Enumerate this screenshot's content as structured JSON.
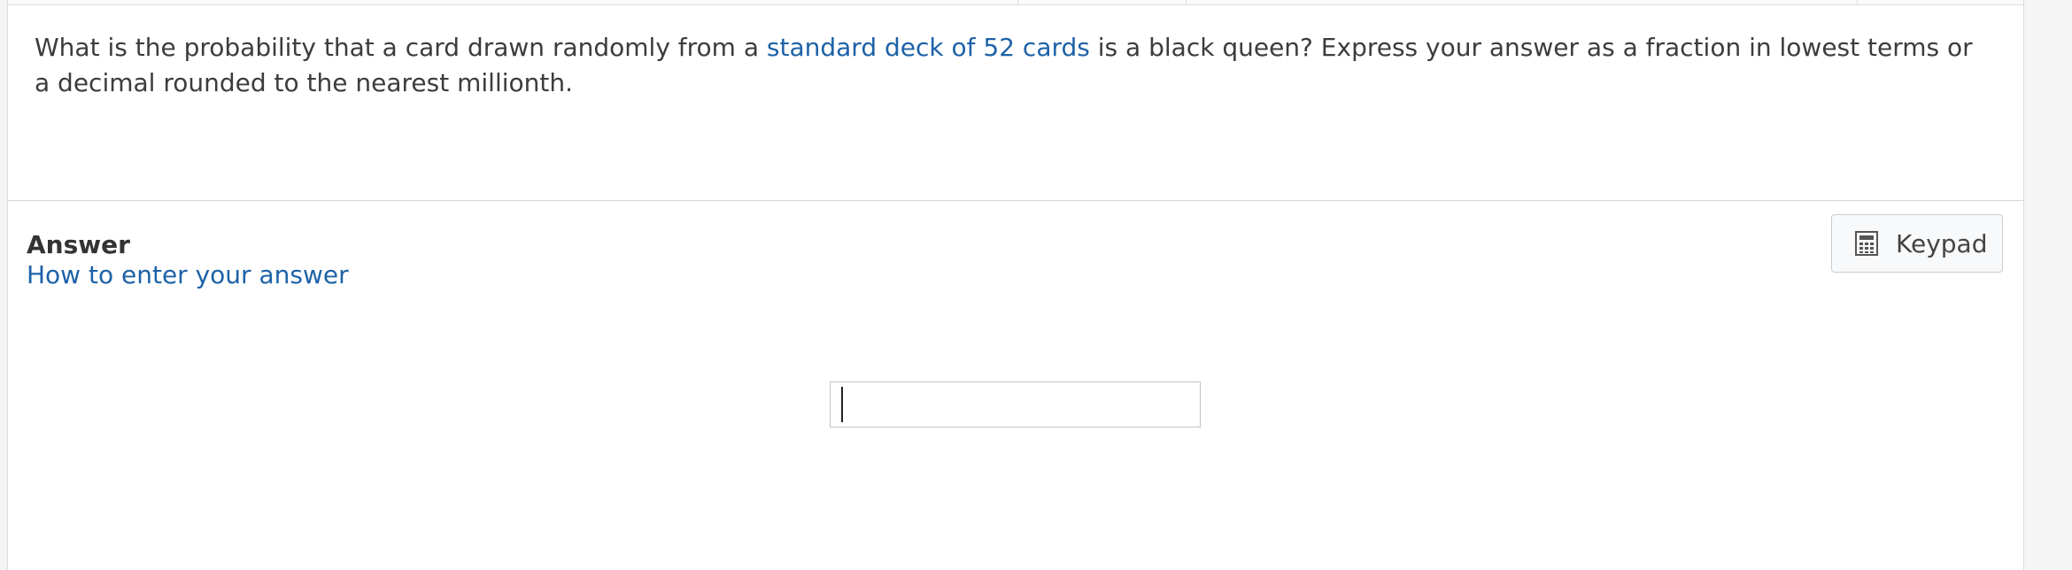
{
  "question": {
    "text_before": "What is the probability that a card drawn randomly from a ",
    "link_text": "standard deck of 52 cards",
    "text_after": " is a black queen? Express your answer as a fraction in lowest terms or a decimal rounded to the nearest millionth."
  },
  "answer": {
    "label": "Answer",
    "help_link": "How to enter your answer",
    "input_value": "",
    "input_placeholder": ""
  },
  "keypad": {
    "label": "Keypad",
    "icon": "calculator-icon"
  },
  "colors": {
    "link": "#1d62a8",
    "text": "#3c3c3c",
    "border": "#d6d6d6"
  }
}
